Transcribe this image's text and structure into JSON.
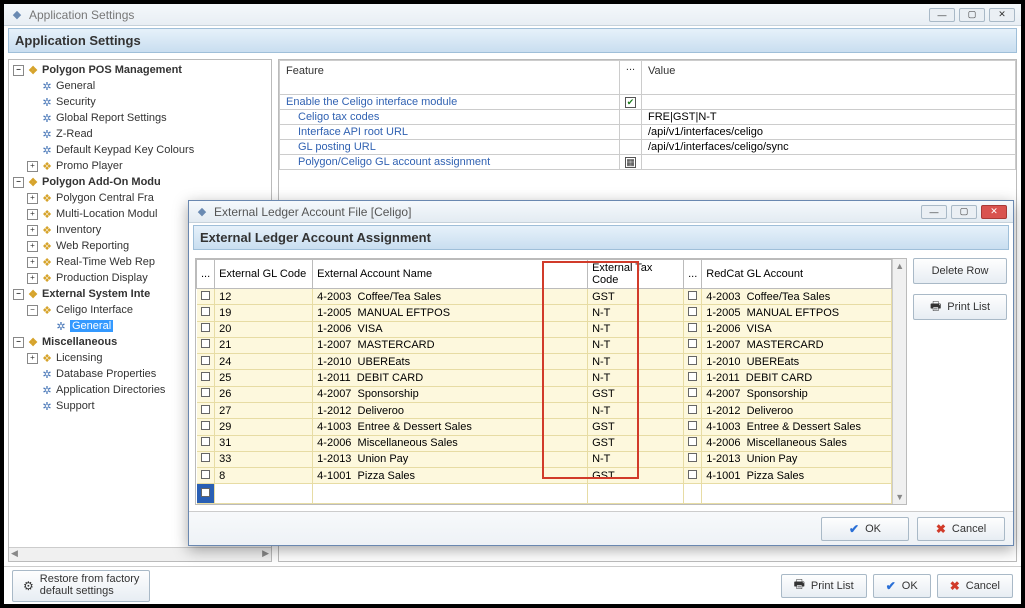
{
  "main_window": {
    "title": "Application Settings",
    "header": "Application Settings"
  },
  "tree": {
    "groups": [
      {
        "label": "Polygon POS Management",
        "bold": true,
        "tgl": "−",
        "ic": "gold",
        "children": [
          {
            "label": "General",
            "ic": "blue"
          },
          {
            "label": "Security",
            "ic": "blue"
          },
          {
            "label": "Global Report Settings",
            "ic": "blue"
          },
          {
            "label": "Z-Read",
            "ic": "blue"
          },
          {
            "label": "Default Keypad Key Colours",
            "ic": "blue"
          },
          {
            "label": "Promo Player",
            "ic": "gold",
            "tgl": "+"
          }
        ]
      },
      {
        "label": "Polygon Add-On Modu",
        "bold": true,
        "tgl": "−",
        "ic": "gold",
        "children": [
          {
            "label": "Polygon Central Fra",
            "ic": "gold",
            "tgl": "+"
          },
          {
            "label": "Multi-Location Modul",
            "ic": "gold",
            "tgl": "+"
          },
          {
            "label": "Inventory",
            "ic": "gold",
            "tgl": "+"
          },
          {
            "label": "Web Reporting",
            "ic": "gold",
            "tgl": "+"
          },
          {
            "label": "Real-Time Web Rep",
            "ic": "gold",
            "tgl": "+"
          },
          {
            "label": "Production Display",
            "ic": "gold",
            "tgl": "+"
          }
        ]
      },
      {
        "label": "External System Inte",
        "bold": true,
        "tgl": "−",
        "ic": "gold",
        "children": [
          {
            "label": "Celigo Interface",
            "ic": "gold",
            "tgl": "−",
            "children": [
              {
                "label": "General",
                "ic": "blue",
                "sel": true
              }
            ]
          }
        ]
      },
      {
        "label": "Miscellaneous",
        "bold": true,
        "tgl": "−",
        "ic": "gold",
        "children": [
          {
            "label": "Licensing",
            "ic": "gold",
            "tgl": "+"
          },
          {
            "label": "Database Properties",
            "ic": "blue"
          },
          {
            "label": "Application Directories",
            "ic": "blue"
          },
          {
            "label": "Support",
            "ic": "blue"
          }
        ]
      }
    ]
  },
  "settings": {
    "columns": {
      "feature": "Feature",
      "dots": "...",
      "value": "Value"
    },
    "rows": [
      {
        "f": "Enable the Celigo interface module",
        "link": true,
        "indent": false,
        "icon": "check",
        "v": ""
      },
      {
        "f": "Celigo tax codes",
        "link": true,
        "indent": true,
        "icon": "",
        "v": "FRE|GST|N-T"
      },
      {
        "f": "Interface API root URL",
        "link": true,
        "indent": true,
        "icon": "",
        "v": "/api/v1/interfaces/celigo"
      },
      {
        "f": "GL posting URL",
        "link": true,
        "indent": true,
        "icon": "",
        "v": "/api/v1/interfaces/celigo/sync"
      },
      {
        "f": "Polygon/Celigo GL account assignment",
        "link": true,
        "indent": true,
        "icon": "grid",
        "v": ""
      }
    ]
  },
  "bottom": {
    "restore": "Restore from factory\ndefault settings",
    "print": "Print List",
    "ok": "OK",
    "cancel": "Cancel"
  },
  "modal": {
    "title": "External Ledger Account File  [Celigo]",
    "header": "External Ledger Account Assignment",
    "columns": {
      "dots": "...",
      "c1": "External GL Code",
      "c2": "External Account Name",
      "c3": "External Tax Code",
      "dots2": "...",
      "c4": "RedCat GL Account"
    },
    "rows": [
      {
        "id": "12",
        "acct": "4-2003",
        "name": "Coffee/Tea Sales",
        "tax": "GST",
        "rc_acct": "4-2003",
        "rc": "Coffee/Tea Sales"
      },
      {
        "id": "19",
        "acct": "1-2005",
        "name": "MANUAL EFTPOS",
        "tax": "N-T",
        "rc_acct": "1-2005",
        "rc": "MANUAL EFTPOS"
      },
      {
        "id": "20",
        "acct": "1-2006",
        "name": "VISA",
        "tax": "N-T",
        "rc_acct": "1-2006",
        "rc": "VISA"
      },
      {
        "id": "21",
        "acct": "1-2007",
        "name": "MASTERCARD",
        "tax": "N-T",
        "rc_acct": "1-2007",
        "rc": "MASTERCARD"
      },
      {
        "id": "24",
        "acct": "1-2010",
        "name": "UBEREats",
        "tax": "N-T",
        "rc_acct": "1-2010",
        "rc": "UBEREats"
      },
      {
        "id": "25",
        "acct": "1-2011",
        "name": "DEBIT CARD",
        "tax": "N-T",
        "rc_acct": "1-2011",
        "rc": "DEBIT CARD"
      },
      {
        "id": "26",
        "acct": "4-2007",
        "name": "Sponsorship",
        "tax": "GST",
        "rc_acct": "4-2007",
        "rc": "Sponsorship"
      },
      {
        "id": "27",
        "acct": "1-2012",
        "name": "Deliveroo",
        "tax": "N-T",
        "rc_acct": "1-2012",
        "rc": "Deliveroo"
      },
      {
        "id": "29",
        "acct": "4-1003",
        "name": "Entree & Dessert Sales",
        "tax": "GST",
        "rc_acct": "4-1003",
        "rc": "Entree & Dessert Sales"
      },
      {
        "id": "31",
        "acct": "4-2006",
        "name": "Miscellaneous Sales",
        "tax": "GST",
        "rc_acct": "4-2006",
        "rc": "Miscellaneous Sales"
      },
      {
        "id": "33",
        "acct": "1-2013",
        "name": "Union Pay",
        "tax": "N-T",
        "rc_acct": "1-2013",
        "rc": "Union Pay"
      },
      {
        "id": "8",
        "acct": "4-1001",
        "name": "Pizza Sales",
        "tax": "GST",
        "rc_acct": "4-1001",
        "rc": "Pizza Sales"
      }
    ],
    "buttons": {
      "delete": "Delete Row",
      "print": "Print List",
      "ok": "OK",
      "cancel": "Cancel"
    }
  }
}
